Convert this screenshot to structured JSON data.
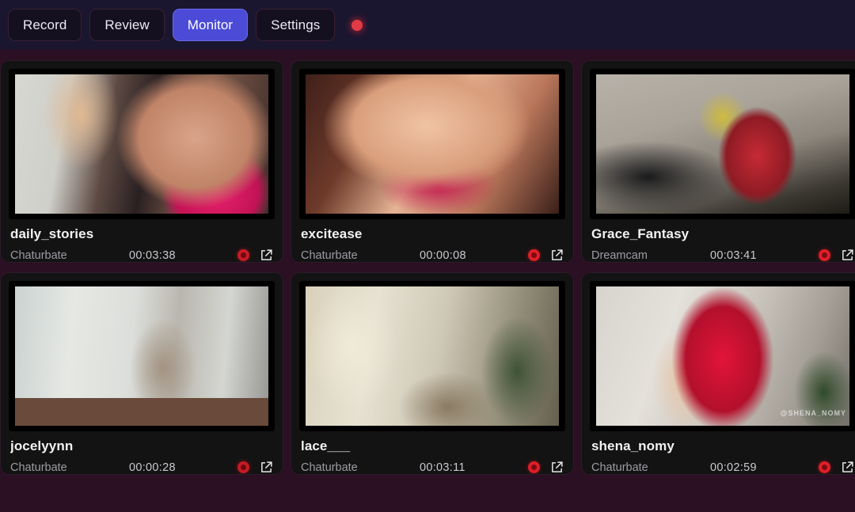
{
  "tabs": [
    {
      "label": "Record",
      "active": false
    },
    {
      "label": "Review",
      "active": false
    },
    {
      "label": "Monitor",
      "active": true
    },
    {
      "label": "Settings",
      "active": false
    }
  ],
  "status_indicator": {
    "name": "recording-status-dot",
    "color": "#e03b44"
  },
  "theme": {
    "page_background": "#2b0f22",
    "topbar_background": "#1b1630",
    "card_background": "#131313",
    "active_tab": "#4b4bd8",
    "record_red": "#c71b25",
    "name_text": "#f2f2f4",
    "muted_text": "#9c9ca3"
  },
  "cards": [
    {
      "name": "daily_stories",
      "platform": "Chaturbate",
      "duration": "00:03:38",
      "rec_bright": false,
      "watermark": ""
    },
    {
      "name": "excitease",
      "platform": "Chaturbate",
      "duration": "00:00:08",
      "rec_bright": true,
      "watermark": ""
    },
    {
      "name": "Grace_Fantasy",
      "platform": "Dreamcam",
      "duration": "00:03:41",
      "rec_bright": true,
      "watermark": ""
    },
    {
      "name": "jocelyynn",
      "platform": "Chaturbate",
      "duration": "00:00:28",
      "rec_bright": false,
      "watermark": ""
    },
    {
      "name": "lace___",
      "platform": "Chaturbate",
      "duration": "00:03:11",
      "rec_bright": true,
      "watermark": ""
    },
    {
      "name": "shena_nomy",
      "platform": "Chaturbate",
      "duration": "00:02:59",
      "rec_bright": true,
      "watermark": "@SHENA_NOMY"
    }
  ],
  "icons": {
    "record_stop": "record-stop-icon",
    "open_external": "open-external-icon"
  }
}
